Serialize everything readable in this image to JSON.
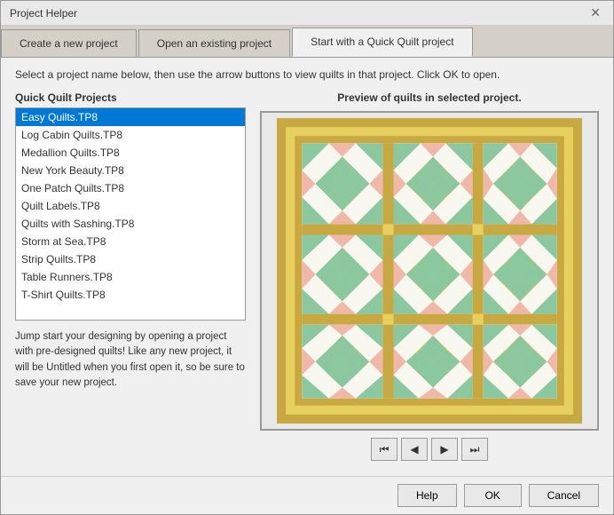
{
  "window": {
    "title": "Project Helper",
    "close_label": "✕"
  },
  "tabs": [
    {
      "id": "new",
      "label": "Create a new project",
      "active": false
    },
    {
      "id": "open",
      "label": "Open an existing project",
      "active": false
    },
    {
      "id": "quick",
      "label": "Start with a Quick Quilt project",
      "active": true
    }
  ],
  "instruction": "Select a project name below, then use the arrow buttons to view quilts in that project. Click OK to open.",
  "left_panel": {
    "label": "Quick Quilt Projects",
    "items": [
      {
        "id": "easy",
        "label": "Easy Quilts.TP8",
        "selected": true
      },
      {
        "id": "log",
        "label": "Log Cabin Quilts.TP8",
        "selected": false
      },
      {
        "id": "medallion",
        "label": "Medallion Quilts.TP8",
        "selected": false
      },
      {
        "id": "newyork",
        "label": "New York Beauty.TP8",
        "selected": false
      },
      {
        "id": "onepatch",
        "label": "One Patch Quilts.TP8",
        "selected": false
      },
      {
        "id": "labels",
        "label": "Quilt Labels.TP8",
        "selected": false
      },
      {
        "id": "sashing",
        "label": "Quilts with Sashing.TP8",
        "selected": false
      },
      {
        "id": "storm",
        "label": "Storm at Sea.TP8",
        "selected": false
      },
      {
        "id": "strip",
        "label": "Strip Quilts.TP8",
        "selected": false
      },
      {
        "id": "runners",
        "label": "Table Runners.TP8",
        "selected": false
      },
      {
        "id": "tshirt",
        "label": "T-Shirt Quilts.TP8",
        "selected": false
      }
    ],
    "description": "Jump start your designing by opening a project with pre-designed quilts! Like any new project, it will be Untitled when you first open it, so be sure to save your new project."
  },
  "right_panel": {
    "label": "Preview of quilts in selected project."
  },
  "nav_buttons": [
    {
      "id": "first",
      "icon": "⏮",
      "label": "First"
    },
    {
      "id": "prev",
      "icon": "◀",
      "label": "Previous"
    },
    {
      "id": "next",
      "icon": "▶",
      "label": "Next"
    },
    {
      "id": "last",
      "icon": "⏭",
      "label": "Last"
    }
  ],
  "bottom_buttons": [
    {
      "id": "help",
      "label": "Help"
    },
    {
      "id": "ok",
      "label": "OK"
    },
    {
      "id": "cancel",
      "label": "Cancel"
    }
  ],
  "colors": {
    "accent_blue": "#0078d7",
    "quilt_green": "#8bc8a0",
    "quilt_yellow": "#e8d060",
    "quilt_pink": "#f0b8a8",
    "quilt_white": "#f8f8f8",
    "quilt_border": "#c8a840",
    "quilt_bg": "#d4c870"
  }
}
